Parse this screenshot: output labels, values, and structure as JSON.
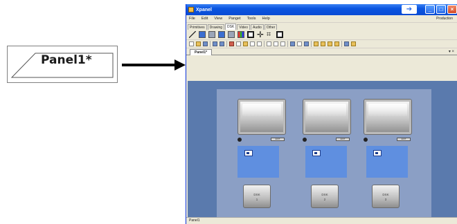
{
  "callout": {
    "tab_label": "Panel1",
    "modified_marker": "*"
  },
  "window": {
    "title": "Xpanel",
    "menu": [
      "File",
      "Edit",
      "View",
      "Panget",
      "Tools",
      "Help"
    ],
    "mode_label": "Production",
    "tool_tabs": [
      "Primitives",
      "Drawing",
      "DSK",
      "Video",
      "Audio",
      "Other"
    ],
    "active_tool_tab": "DSK",
    "document_tab": "Panel1*",
    "status_text": "Panel1"
  },
  "panel": {
    "monitor_button_label": "EDIT",
    "dsk_buttons": [
      {
        "line1": "DSK",
        "line2": "1"
      },
      {
        "line1": "DSK",
        "line2": "2"
      },
      {
        "line1": "DSK",
        "line2": "3"
      }
    ]
  },
  "colors": {
    "titlebar": "#0a55e0",
    "canvas_background": "#5a7aad",
    "panel_background": "#8b9fc5",
    "slot_fill": "#5f8fe0"
  },
  "icons": [
    "app-icon",
    "help-arrow-icon",
    "minimize-icon",
    "maximize-icon",
    "close-icon"
  ]
}
